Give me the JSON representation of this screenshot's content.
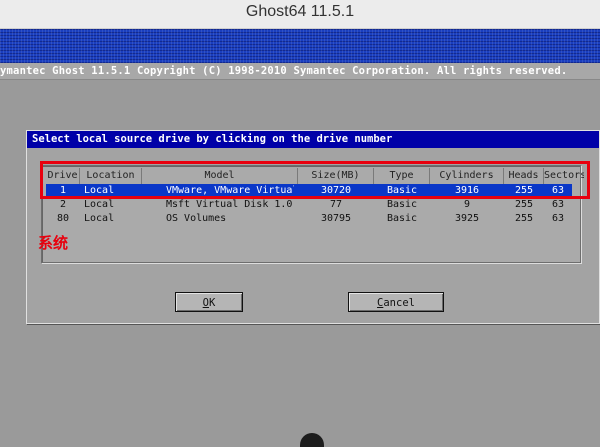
{
  "window": {
    "title": "Ghost64 11.5.1"
  },
  "header": {
    "copyright": "ymantec Ghost 11.5.1  Copyright (C) 1998-2010 Symantec Corporation. All rights reserved."
  },
  "dialog": {
    "title": "Select local source drive by clicking on the drive number",
    "columns": [
      "Drive",
      "Location",
      "Model",
      "Size(MB)",
      "Type",
      "Cylinders",
      "Heads",
      "Sectors"
    ],
    "rows": [
      [
        "1",
        "Local",
        "VMware, VMware Virtual S",
        "30720",
        "Basic",
        "3916",
        "255",
        "63"
      ],
      [
        "2",
        "Local",
        "Msft Virtual Disk 1.0",
        "77",
        "Basic",
        "9",
        "255",
        "63"
      ],
      [
        "80",
        "Local",
        "OS Volumes",
        "30795",
        "Basic",
        "3925",
        "255",
        "63"
      ]
    ],
    "selected_row": 0,
    "ok_accel": "O",
    "ok_rest": "K",
    "cancel_accel": "C",
    "cancel_rest": "ancel"
  },
  "annotation": {
    "text": "系统",
    "color": "#e8000e"
  },
  "colors": {
    "banner": "#1a3fc0",
    "dialog_title": "#0000a8",
    "selection": "#0a37c8",
    "annotation": "#e8000e"
  }
}
